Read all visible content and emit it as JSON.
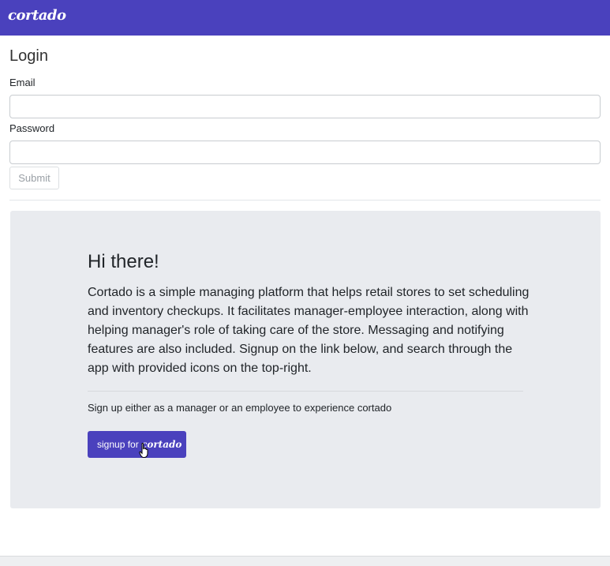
{
  "navbar": {
    "brand": "cortado"
  },
  "login": {
    "title": "Login",
    "email_label": "Email",
    "email_value": "",
    "password_label": "Password",
    "password_value": "",
    "submit_label": "Submit"
  },
  "intro": {
    "heading": "Hi there!",
    "description": "Cortado is a simple managing platform that helps retail stores to set scheduling and inventory checkups. It facilitates manager-employee interaction, along with helping manager's role of taking care of the store. Messaging and notifying features are also included. Signup on the link below, and search through the app with provided icons on the top-right.",
    "signup_note": "Sign up either as a manager or an employee to experience cortado",
    "signup_button_prefix": "signup for ",
    "signup_button_brand": "cortado"
  },
  "colors": {
    "accent": "#4a41bd",
    "jumbotron_bg": "#e9ebef"
  }
}
